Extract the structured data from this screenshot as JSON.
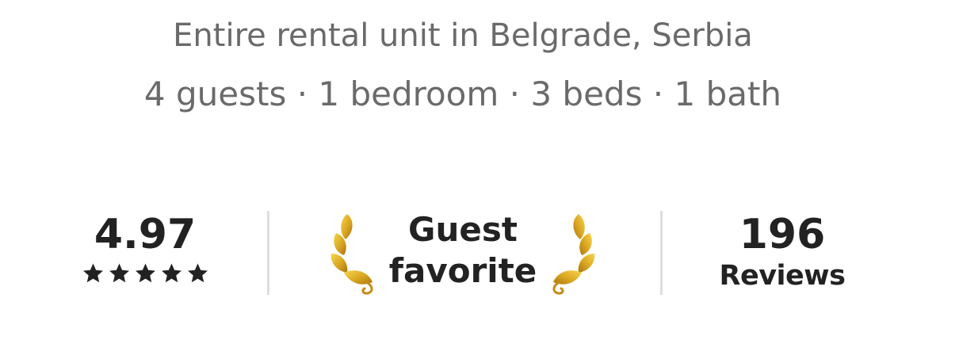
{
  "listing": {
    "type_location": "Entire rental unit in Belgrade, Serbia",
    "details": "4 guests · 1 bedroom · 3 beds · 1 bath"
  },
  "stats": {
    "rating": "4.97",
    "stars_count": 5,
    "star_icon": "star-icon",
    "badge_line1": "Guest",
    "badge_line2": "favorite",
    "laurel_icon": "laurel-icon",
    "laurel_color": "#d4a017",
    "reviews_count": "196",
    "reviews_label": "Reviews"
  }
}
